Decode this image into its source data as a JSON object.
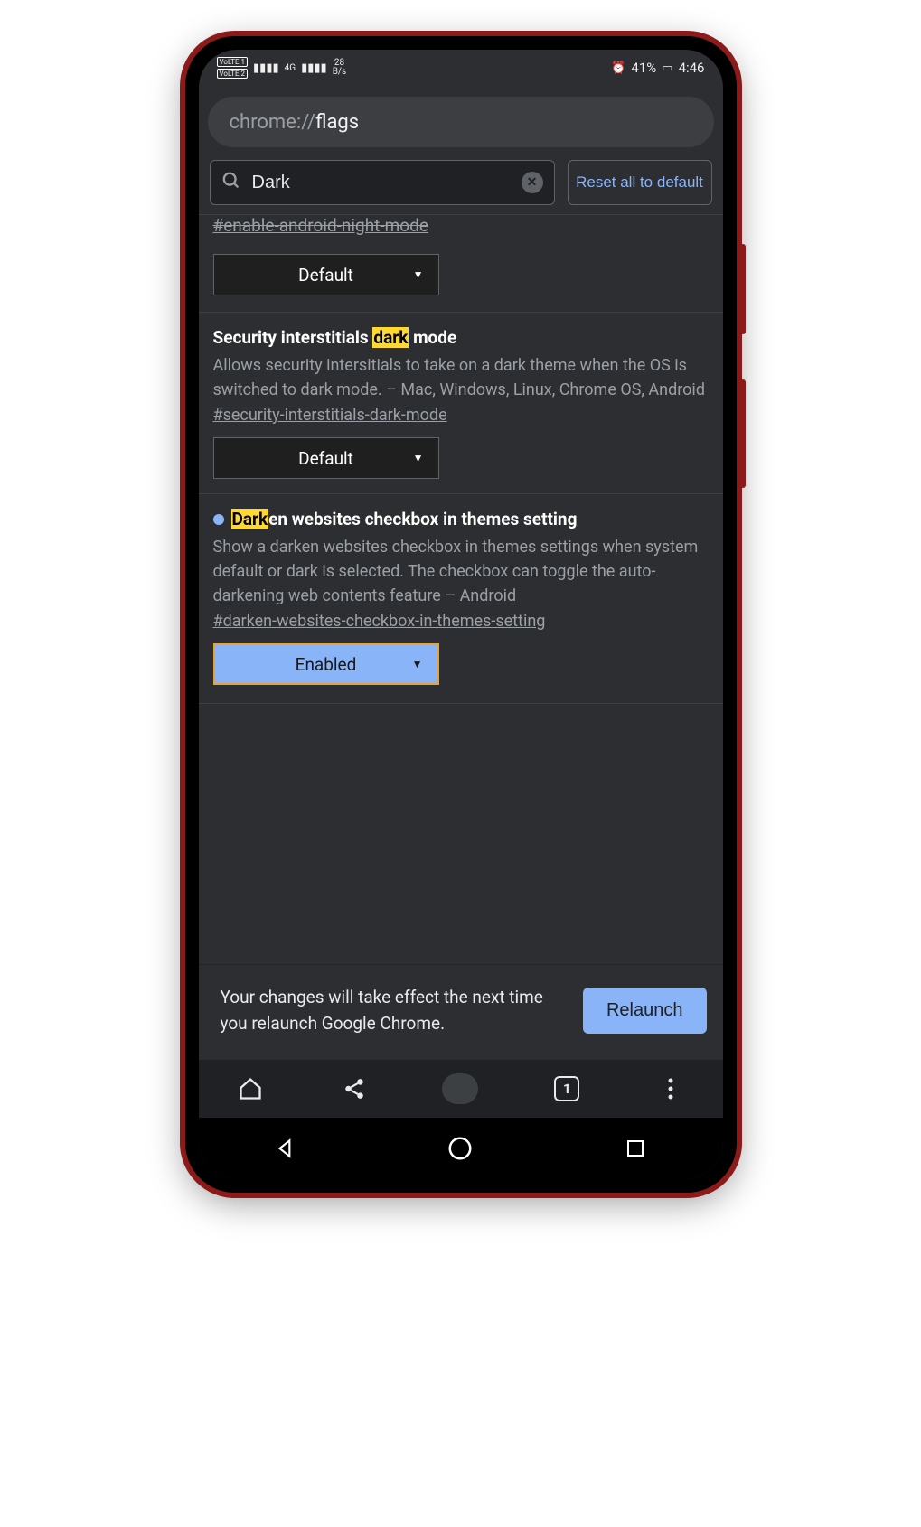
{
  "status": {
    "volte1": "VoLTE 1",
    "volte2": "VoLTE 2",
    "signal_label": "4G",
    "net_speed_top": "28",
    "net_speed_bottom": "B/s",
    "battery_pct": "41%",
    "time": "4:46"
  },
  "omnibox": {
    "scheme": "chrome://",
    "host": "flags"
  },
  "toolbar": {
    "search_value": "Dark",
    "reset_label": "Reset all to default"
  },
  "flags": [
    {
      "partial_hash": "#enable-android-night-mode",
      "select_value": "Default",
      "select_state": "default"
    },
    {
      "title_pre": "Security interstitials ",
      "title_hl": "dark",
      "title_post": " mode",
      "desc": "Allows security intersitials to take on a dark theme when the OS is switched to dark mode. – Mac, Windows, Linux, Chrome OS, Android",
      "hash": "#security-interstitials-dark-mode",
      "select_value": "Default",
      "select_state": "default"
    },
    {
      "indicator": true,
      "title_hl": "Dark",
      "title_post": "en websites checkbox in themes setting",
      "desc": "Show a darken websites checkbox in themes settings when system default or dark is selected. The checkbox can toggle the auto-darkening web contents feature – Android",
      "hash": "#darken-websites-checkbox-in-themes-setting",
      "select_value": "Enabled",
      "select_state": "enabled"
    }
  ],
  "relaunch": {
    "message": "Your changes will take effect the next time you relaunch Google Chrome.",
    "button": "Relaunch"
  },
  "browser_nav": {
    "tab_count": "1"
  }
}
